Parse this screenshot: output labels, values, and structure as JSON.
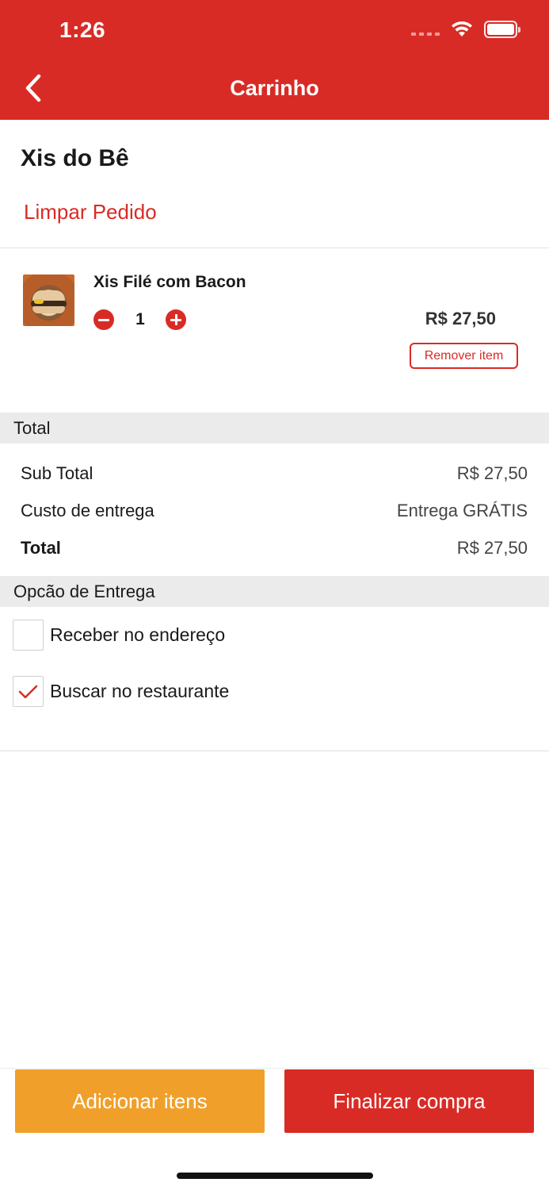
{
  "status_bar": {
    "time": "1:26"
  },
  "header": {
    "title": "Carrinho"
  },
  "restaurant": {
    "name": "Xis do Bê",
    "clear_label": "Limpar Pedido"
  },
  "cart_items": [
    {
      "name": "Xis Filé com Bacon",
      "quantity": "1",
      "price": "R$ 27,50",
      "remove_label": "Remover item"
    }
  ],
  "total_section": {
    "title": "Total",
    "rows": [
      {
        "label": "Sub Total",
        "value": "R$ 27,50"
      },
      {
        "label": "Custo de entrega",
        "value": "Entrega GRÁTIS"
      },
      {
        "label": "Total",
        "value": "R$ 27,50"
      }
    ]
  },
  "delivery_section": {
    "title": "Opcão de Entrega",
    "options": [
      {
        "label": "Receber no endereço",
        "checked": false
      },
      {
        "label": "Buscar no restaurante",
        "checked": true
      }
    ]
  },
  "footer": {
    "add_label": "Adicionar itens",
    "checkout_label": "Finalizar compra"
  },
  "colors": {
    "primary": "#d92b25",
    "secondary": "#f0a02a",
    "section_bg": "#ebebeb"
  }
}
